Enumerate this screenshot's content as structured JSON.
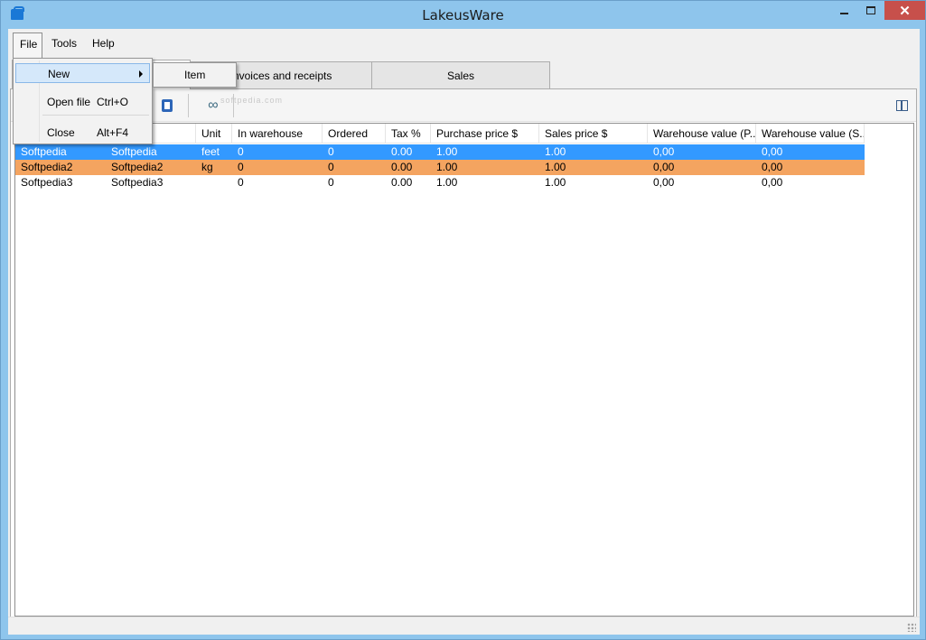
{
  "window": {
    "title": "LakeusWare"
  },
  "menubar": {
    "file": "File",
    "tools": "Tools",
    "help": "Help"
  },
  "file_menu": {
    "new": "New",
    "open_file": "Open file",
    "open_file_shortcut": "Ctrl+O",
    "close": "Close",
    "close_shortcut": "Alt+F4"
  },
  "new_submenu": {
    "item": "Item"
  },
  "tabs": [
    {
      "label": ""
    },
    {
      "label": "Invoices and receipts"
    },
    {
      "label": "Sales"
    }
  ],
  "toolbar": {
    "watermark": "softpedia.com"
  },
  "grid": {
    "columns": [
      "",
      "n",
      "Unit",
      "In warehouse",
      "Ordered",
      "Tax %",
      "Purchase price $",
      "Sales price $",
      "Warehouse value (P...",
      "Warehouse value (S..."
    ],
    "rows": [
      {
        "state": "selected",
        "cells": [
          "Softpedia",
          "Softpedia",
          "feet",
          "0",
          "0",
          "0.00",
          "1.00",
          "1.00",
          "0,00",
          "0,00"
        ]
      },
      {
        "state": "highlight",
        "cells": [
          "Softpedia2",
          "Softpedia2",
          "kg",
          "0",
          "0",
          "0.00",
          "1.00",
          "1.00",
          "0,00",
          "0,00"
        ]
      },
      {
        "state": "normal",
        "cells": [
          "Softpedia3",
          "Softpedia3",
          "",
          "0",
          "0",
          "0.00",
          "1.00",
          "1.00",
          "0,00",
          "0,00"
        ]
      }
    ]
  },
  "colors": {
    "selection": "#3399ff",
    "highlight": "#f4a460",
    "titlebar": "#8ec5ec",
    "close_button": "#c7504b"
  },
  "icons": [
    "app-icon",
    "minimize-icon",
    "maximize-icon",
    "close-icon",
    "open-folder-icon",
    "document-icon",
    "glasses-icon",
    "columns-icon",
    "submenu-arrow-icon",
    "size-grip-icon"
  ]
}
